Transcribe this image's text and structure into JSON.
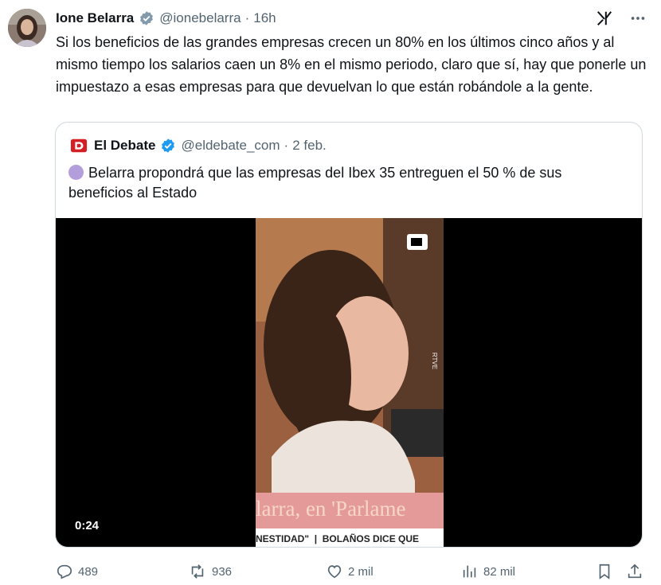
{
  "author": {
    "name": "Ione Belarra",
    "handle": "@ionebelarra",
    "separator": "·",
    "time": "16h"
  },
  "tweet": {
    "text": "Si los beneficios de las grandes empresas crecen un 80% en los últimos cinco años y al mismo tiempo los salarios caen un 8% en el mismo periodo, claro que sí, hay que ponerle un impuestazo a esas empresas para que devuelvan lo que están robándole a la gente."
  },
  "quote": {
    "name": "El Debate",
    "handle": "@eldebate_com",
    "separator": "·",
    "date": "2 feb.",
    "text": "Belarra propondrá que las empresas del Ibex 35 entreguen el 50 % de sus beneficios al Estado",
    "video": {
      "duration": "0:24",
      "caption": "larra, en 'Parlame",
      "ticker": "NESTIDAD\"  |  BOLAÑOS DICE QUE",
      "watermark": "RTVE"
    }
  },
  "actions": {
    "replies": "489",
    "reposts": "936",
    "likes": "2 mil",
    "views": "82 mil"
  },
  "colors": {
    "verified": "#1d9bf0",
    "muted": "#536471",
    "border": "#cfd9de",
    "debate_red": "#d32027"
  }
}
